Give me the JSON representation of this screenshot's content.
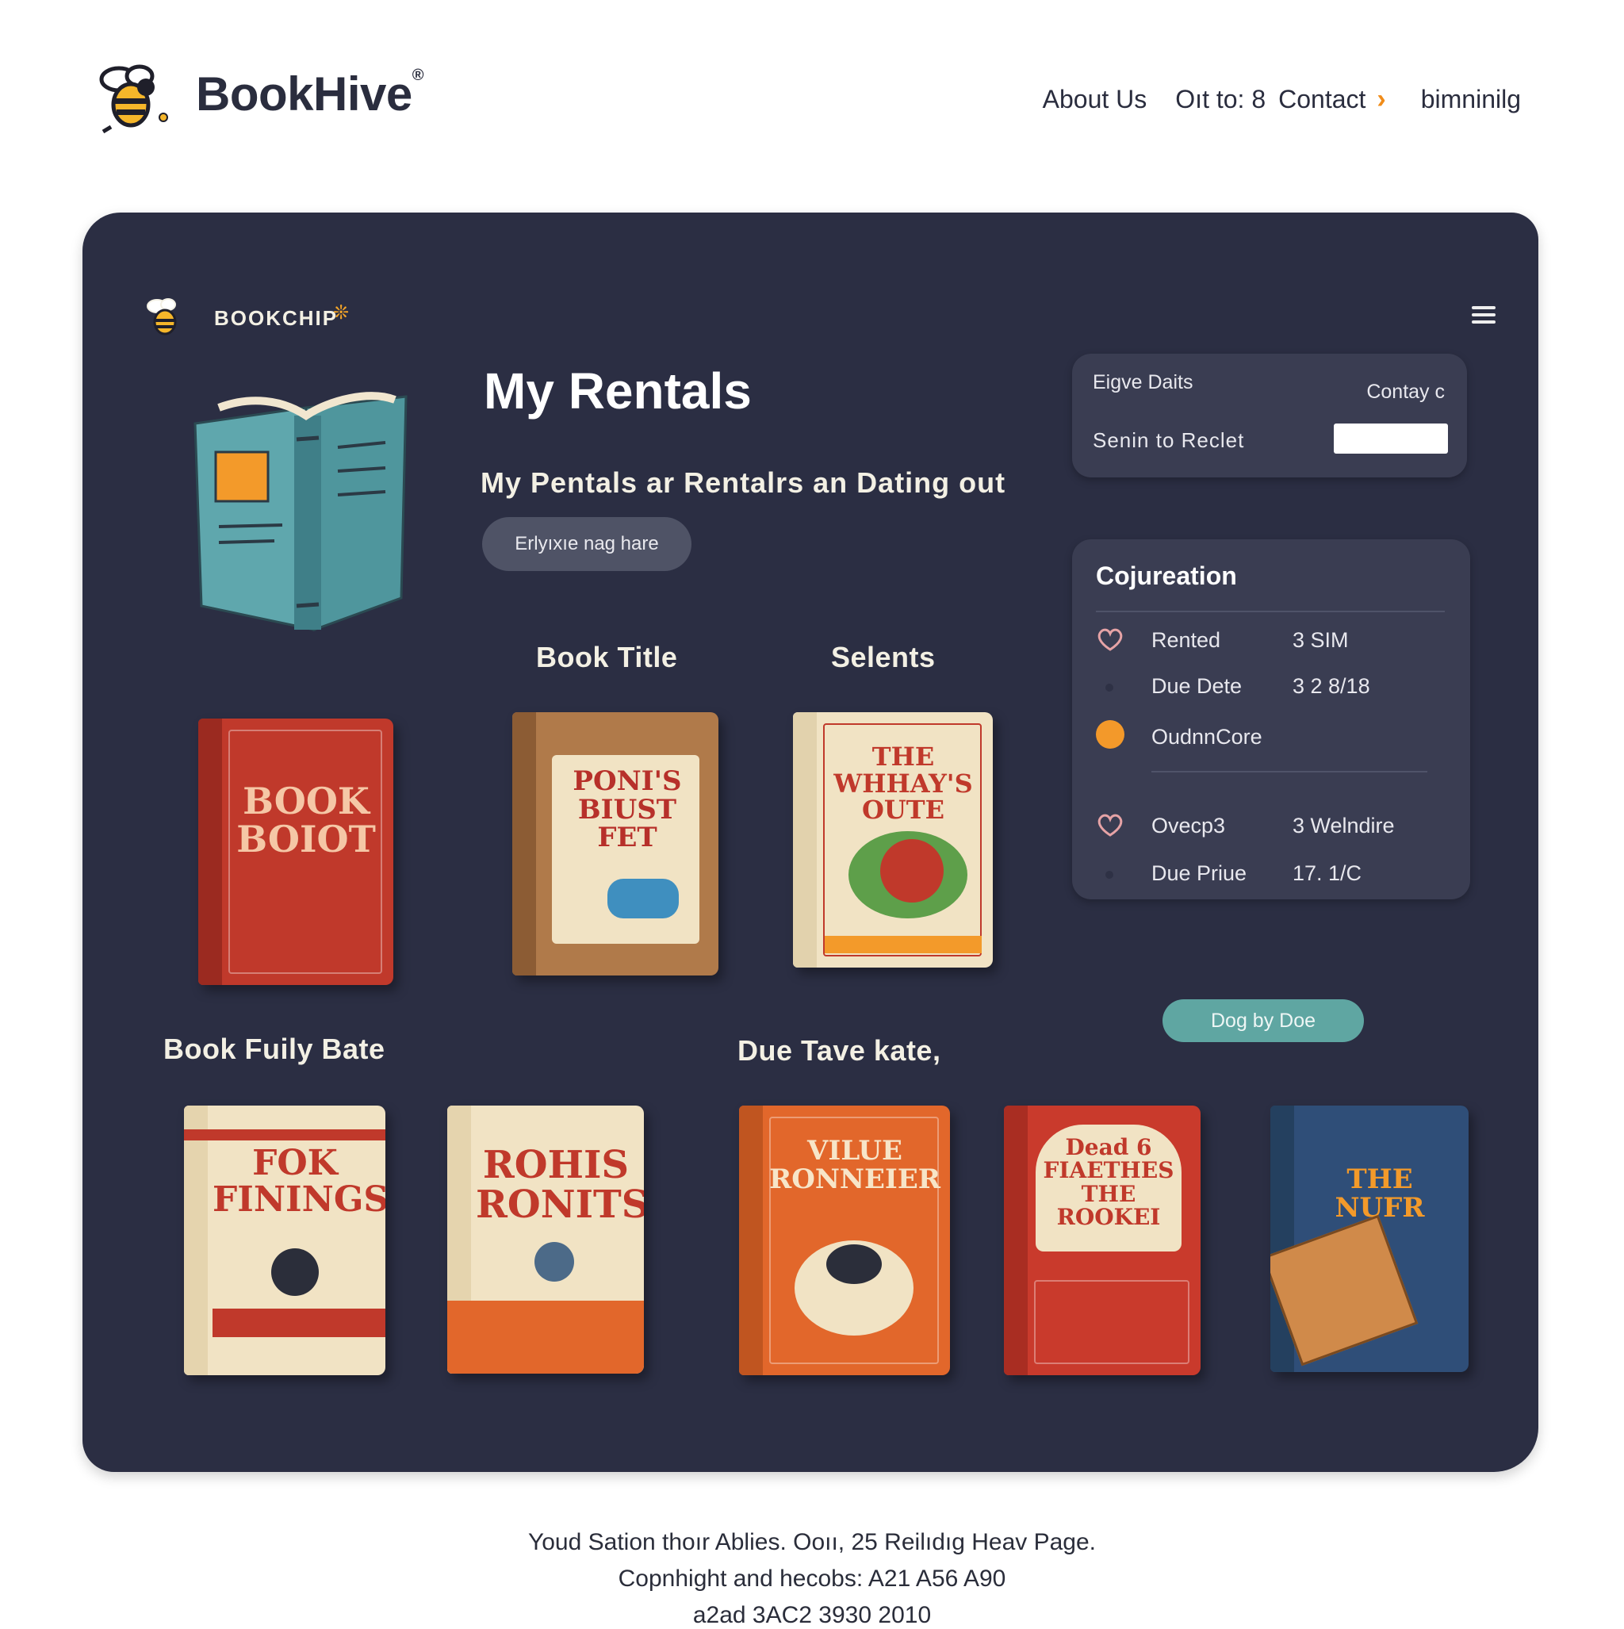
{
  "header": {
    "brand": "BookHive",
    "brand_mark": "®",
    "nav": {
      "about": "About Us",
      "extra": "Oıt to: 8",
      "contact": "Contact",
      "chevron": "›",
      "last": "bimninilg"
    }
  },
  "panel": {
    "brand": "BOOKCHIP",
    "brand_bee": "❊",
    "title": "My Rentals",
    "subtitle": "My Pentals ar Rentalrs an Dating out",
    "pill_button": "Erlyıxıe nag hare",
    "labels": {
      "book_title": "Book Title",
      "selects": "Selents",
      "book_fuily": "Book Fuily Bate",
      "due_tave": "Due Tave kate,"
    },
    "card1": {
      "left_top": "Eigve Daits",
      "right_top": "Contay c",
      "left_bottom": "Senin to Reclet",
      "input_value": ""
    },
    "card2": {
      "title": "Cojureation",
      "rows": [
        {
          "label": "Rented",
          "value": "3   SIM"
        },
        {
          "label": "Due Dete",
          "value": "3  2 8/18"
        },
        {
          "label": "OudnnCore",
          "value": ""
        },
        {
          "label": "Ovecp3",
          "value": "3   Welndire"
        },
        {
          "label": "Due Priue",
          "value": "17. 1/C"
        }
      ]
    },
    "teal_button": "Dog by Doe",
    "books": [
      {
        "title": "BOOK BOIOT",
        "color": "#c0392b"
      },
      {
        "title": "PONI'S BIUST FET",
        "color": "#b07a4a"
      },
      {
        "title": "THE WHHAY'S OUTE",
        "color": "#f1e3c4"
      },
      {
        "title": "FOK FININGS",
        "color": "#f1e3c4"
      },
      {
        "title": "ROHIS RONITS",
        "color": "#f1e3c4"
      },
      {
        "title": "VILUE RONNEIER",
        "color": "#e2672b"
      },
      {
        "title": "Dead 6 FIAETHES THE ROOKEI",
        "color": "#c93a2c"
      },
      {
        "title": "THE NUFR",
        "color": "#2f4e78"
      }
    ]
  },
  "footer": {
    "line1": "Youd Sation thoır Ablies. Ooıı, 25 Reilıdıg Heav Page.",
    "line2": "Copnhight and hecobs: A21 A56 A90",
    "line3": "a2ad 3AC2 3930 2010"
  }
}
